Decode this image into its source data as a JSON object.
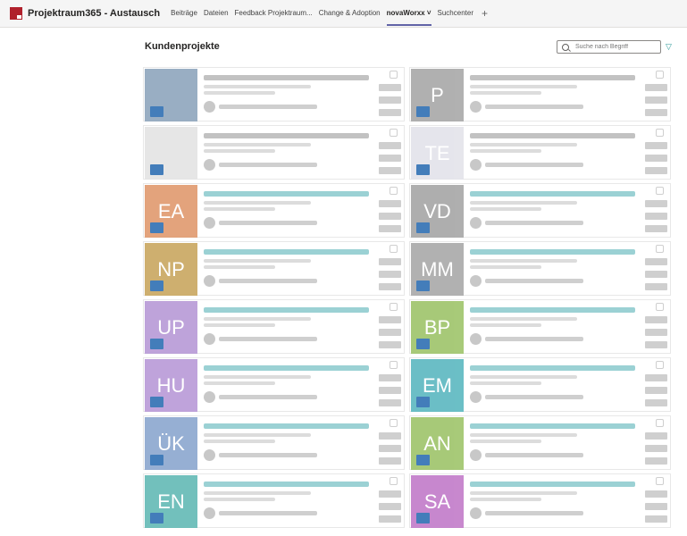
{
  "app": {
    "title": "Projektraum365 - Austausch"
  },
  "tabs": [
    {
      "label": "Beiträge"
    },
    {
      "label": "Dateien"
    },
    {
      "label": "Feedback Projektraum..."
    },
    {
      "label": "Change & Adoption"
    },
    {
      "label": "novaWorxx ˅"
    },
    {
      "label": "Suchcenter"
    }
  ],
  "page": {
    "heading": "Kundenprojekte"
  },
  "search": {
    "placeholder": "Suche nach Begriff"
  },
  "cards": [
    {
      "initials": "",
      "color": "#8fa6bd",
      "title_color": "#9a9a9a"
    },
    {
      "initials": "P",
      "color": "#a8a8a8",
      "title_color": "#9a9a9a"
    },
    {
      "initials": "",
      "color": "#e4e4e4",
      "title_color": "#9a9a9a"
    },
    {
      "initials": "TE",
      "color": "#e3e3ea",
      "title_color": "#9a9a9a"
    },
    {
      "initials": "EA",
      "color": "#e09a6e",
      "title_color": "#59b3b8"
    },
    {
      "initials": "VD",
      "color": "#a6a6a6",
      "title_color": "#59b3b8"
    },
    {
      "initials": "NP",
      "color": "#c9a760",
      "title_color": "#59b3b8"
    },
    {
      "initials": "MM",
      "color": "#a9a9a9",
      "title_color": "#59b3b8"
    },
    {
      "initials": "UP",
      "color": "#b79ad6",
      "title_color": "#59b3b8"
    },
    {
      "initials": "BP",
      "color": "#9ec46a",
      "title_color": "#59b3b8"
    },
    {
      "initials": "HU",
      "color": "#b99ad8",
      "title_color": "#59b3b8"
    },
    {
      "initials": "EM",
      "color": "#5bb8c0",
      "title_color": "#59b3b8"
    },
    {
      "initials": "ÜK",
      "color": "#8ba7cf",
      "title_color": "#59b3b8"
    },
    {
      "initials": "AN",
      "color": "#9ec46a",
      "title_color": "#59b3b8"
    },
    {
      "initials": "EN",
      "color": "#63bab5",
      "title_color": "#59b3b8"
    },
    {
      "initials": "SA",
      "color": "#c27bc9",
      "title_color": "#59b3b8"
    }
  ]
}
